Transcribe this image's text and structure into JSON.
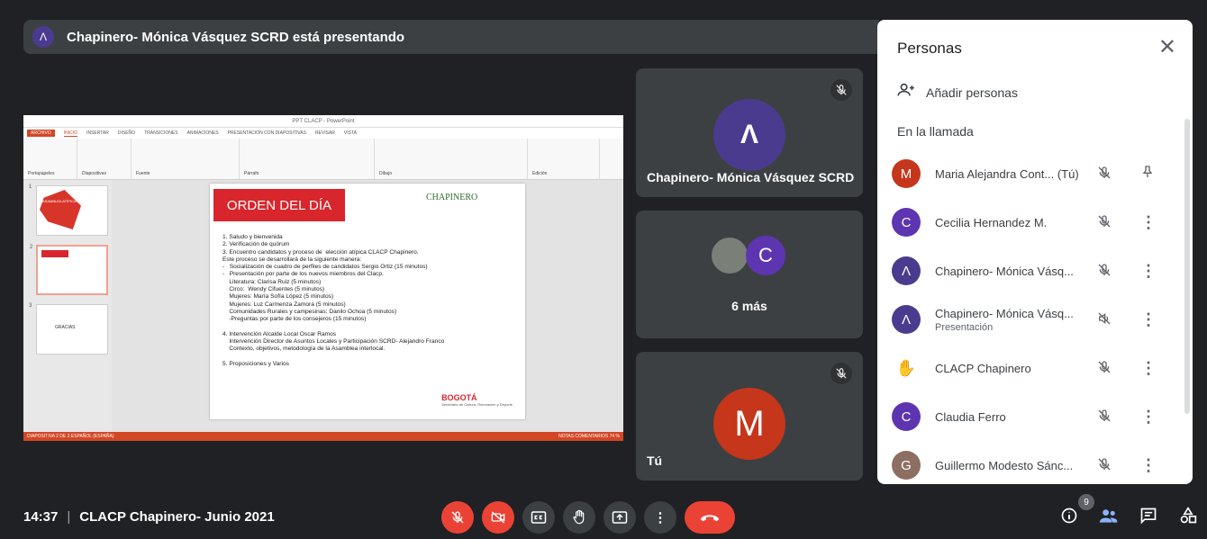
{
  "banner": {
    "text": "Chapinero- Mónica Vásquez SCRD está presentando"
  },
  "screen": {
    "app_title": "PPT CLACP - PowerPoint",
    "tabs": [
      "ARCHIVO",
      "INICIO",
      "INSERTAR",
      "DISEÑO",
      "TRANSICIONES",
      "ANIMACIONES",
      "PRESENTACIÓN CON DIAPOSITIVAS",
      "REVISAR",
      "VISTA"
    ],
    "ribbon_groups": [
      "Portapapeles",
      "Diapositivas",
      "Fuente",
      "Párrafo",
      "Dibujo",
      "Edición"
    ],
    "thumb1_title": "ASAMBLEA ATÍPICA CLACP",
    "thumb3_title": "GRACIAS",
    "slide_title": "ORDEN DEL DÍA",
    "slide_locality": "CHAPINERO",
    "agenda": "1. Saludo y bienvenida\n2. Verificación de quórum\n3. Encuentro candidatos y proceso de  elección atípica CLACP Chapinero.\nEste proceso se desarrollará de la siguiente manera:\n-   Socialización de cuadro de perfiles de candidatos Sergio Ortiz (15 minutos)\n-   Presentación por parte de los nuevos miembros del Clacp.\n    Literatura: Clarisa Ruiz (5 minutos)\n    Circo:  Wendy Cifuentes (5 minutos)\n    Mujeres: María Sofía López (5 minutos)\n    Mujeres: Luz Carmenza Zamora (5 minutos)\n    Comunidades Rurales y campesinas: Danilo Ochoa (5 minutos)\n    -Preguntas por parte de los consejeros (15 minutos)\n\n4. Intervención Alcalde Local Oscar Ramos\n    Intervención Director de Asuntos Locales y Participación SCRD- Alejandro Franco\n    Contexto, objetivos, metodología de la Asamblea interlocal.\n\n5. Proposiciones y Varios",
    "logo": "BOGOTÁ",
    "logo_sub": "Secretaría de Cultura, Recreación y Deporte",
    "status_left": "DIAPOSITIVA 2 DE 3    ESPAÑOL (ESPAÑA)",
    "status_right": "NOTAS   COMENTARIOS   74 %"
  },
  "tiles": {
    "presenter_name": "Chapinero- Mónica Vásquez SCRD",
    "more_label": "6 más",
    "more_initial": "C",
    "self_label": "Tú",
    "self_initial": "M"
  },
  "panel": {
    "title": "Personas",
    "add_label": "Añadir personas",
    "section_label": "En la llamada",
    "people": [
      {
        "initial": "M",
        "name": "Maria Alejandra Cont... (Tú)",
        "sub": "",
        "color": "#c5361b",
        "action": "pin"
      },
      {
        "initial": "C",
        "name": "Cecilia Hernandez M.",
        "sub": "",
        "color": "#5e35b1",
        "action": "more"
      },
      {
        "initial": "Λ",
        "name": "Chapinero- Mónica Vásq...",
        "sub": "",
        "color": "#4b3b8f",
        "action": "more"
      },
      {
        "initial": "Λ",
        "name": "Chapinero- Mónica Vásq...",
        "sub": "Presentación",
        "color": "#4b3b8f",
        "action": "more"
      },
      {
        "initial": "✋",
        "name": "CLACP Chapinero",
        "sub": "",
        "color": "#ffffff",
        "action": "more"
      },
      {
        "initial": "C",
        "name": "Claudia Ferro",
        "sub": "",
        "color": "#5e35b1",
        "action": "more"
      },
      {
        "initial": "G",
        "name": "Guillermo Modesto Sánc...",
        "sub": "",
        "color": "#8d6e63",
        "action": "more"
      }
    ]
  },
  "bottom": {
    "time": "14:37",
    "meeting": "CLACP Chapinero- Junio 2021",
    "participants_count": "9"
  }
}
